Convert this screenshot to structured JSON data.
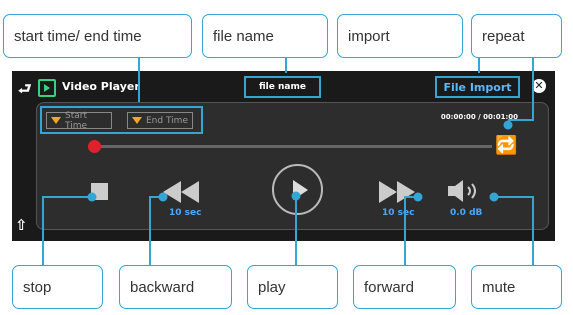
{
  "callouts": {
    "start_end": "start time/ end time",
    "file_name": "file name",
    "import": "import",
    "repeat": "repeat",
    "stop": "stop",
    "backward": "backward",
    "play": "play",
    "forward": "forward",
    "mute": "mute"
  },
  "player": {
    "title": "Video Player",
    "file_name": "file name",
    "import_label": "File Import",
    "start_time_label": "Start Time",
    "end_time_label": "End Time",
    "timecode": "00:00:00 / 00:01:00",
    "backward_caption": "10 sec",
    "forward_caption": "10 sec",
    "volume_caption": "0.0 dB",
    "progress": 0.0
  },
  "colors": {
    "callout": "#33a6d6",
    "accent_text": "#4aa8ff",
    "seek_knob": "#e0202a",
    "time_marker": "#f5a623",
    "app_icon": "#38d27a",
    "player_bg": "#1a1a1a",
    "panel_bg": "#2d2d2d"
  },
  "icons": [
    "back-icon",
    "video-player-icon",
    "close-icon",
    "repeat-icon",
    "stop-icon",
    "rewind-icon",
    "play-icon",
    "fast-forward-icon",
    "volume-icon",
    "home-icon"
  ]
}
